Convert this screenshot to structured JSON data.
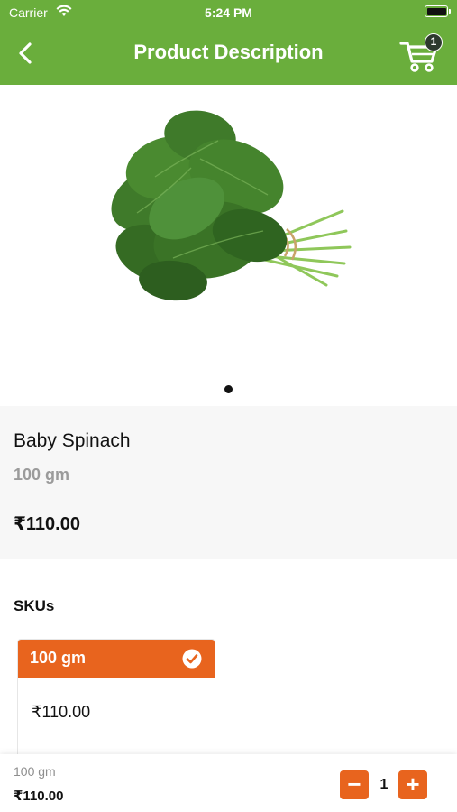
{
  "status_bar": {
    "carrier": "Carrier",
    "time": "5:24 PM"
  },
  "nav": {
    "title": "Product Description",
    "cart_count": "1"
  },
  "product": {
    "name": "Baby Spinach",
    "weight": "100 gm",
    "price": "₹110.00"
  },
  "skus": {
    "heading": "SKUs",
    "items": [
      {
        "label": "100 gm",
        "price": "₹110.00",
        "selected": true
      }
    ]
  },
  "bottom_bar": {
    "weight": "100 gm",
    "price": "₹110.00",
    "quantity": "1",
    "minus_label": "−",
    "plus_label": "+"
  },
  "colors": {
    "header_green": "#6aae3c",
    "accent_orange": "#e8641e",
    "info_bg": "#f7f7f7"
  }
}
